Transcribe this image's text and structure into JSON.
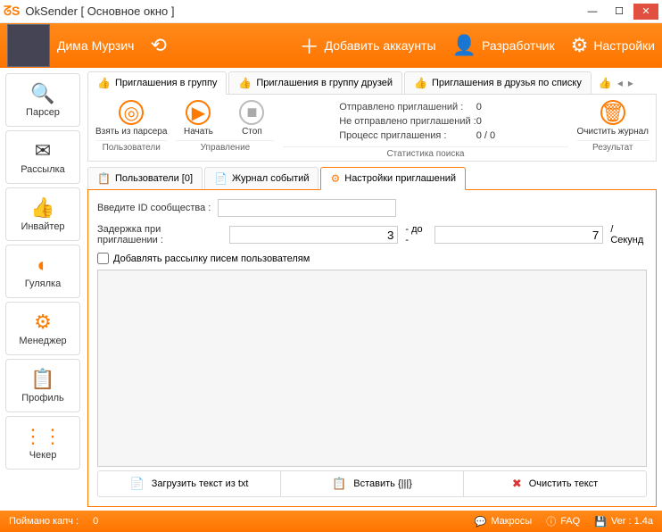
{
  "window": {
    "title": "OkSender [ Основное окно ]"
  },
  "topbar": {
    "username": "Дима Мурзич",
    "add_accounts": "Добавить аккаунты",
    "developer": "Разработчик",
    "settings": "Настройки"
  },
  "sidebar": [
    {
      "label": "Парсер",
      "icon": "🔍"
    },
    {
      "label": "Рассылка",
      "icon": "✉"
    },
    {
      "label": "Инвайтер",
      "icon": "👍"
    },
    {
      "label": "Гулялка",
      "icon": "◐"
    },
    {
      "label": "Менеджер",
      "icon": "⚙"
    },
    {
      "label": "Профиль",
      "icon": "📋"
    },
    {
      "label": "Чекер",
      "icon": "⋮⋮"
    }
  ],
  "tabs1": [
    "Приглашения в группу",
    "Приглашения в группу друзей",
    "Приглашения в друзья по списку"
  ],
  "ribbon": {
    "parser_btn": "Взять из\nпарсера",
    "start": "Начать",
    "stop": "Стоп",
    "clear": "Очистить\nжурнал",
    "cat_users": "Пользователи",
    "cat_control": "Управление",
    "cat_stats": "Статистика поиска",
    "cat_result": "Результат"
  },
  "stats": {
    "sent_label": "Отправлено приглашений :",
    "sent_val": "0",
    "notsent_label": "Не отправлено приглашений :",
    "notsent_val": "0",
    "process_label": "Процесс приглашения :",
    "process_val": "0 / 0"
  },
  "tabs2": [
    "Пользователи [0]",
    "Журнал событий",
    "Настройки приглашений"
  ],
  "form": {
    "community_id": "Введите ID сообщества :",
    "delay": "Задержка при приглашении :",
    "delay_from": "3",
    "delay_sep": "- до -",
    "delay_to": "7",
    "delay_unit": "/ Секунд",
    "add_mailing": "Добавлять рассылку писем пользователям"
  },
  "bottom": {
    "load": "Загрузить текст из txt",
    "paste": "Вставить {|||}",
    "clear": "Очистить текст"
  },
  "status": {
    "captcha": "Поймано капч :",
    "captcha_val": "0",
    "macros": "Макросы",
    "faq": "FAQ",
    "ver": "Ver : 1.4a"
  }
}
